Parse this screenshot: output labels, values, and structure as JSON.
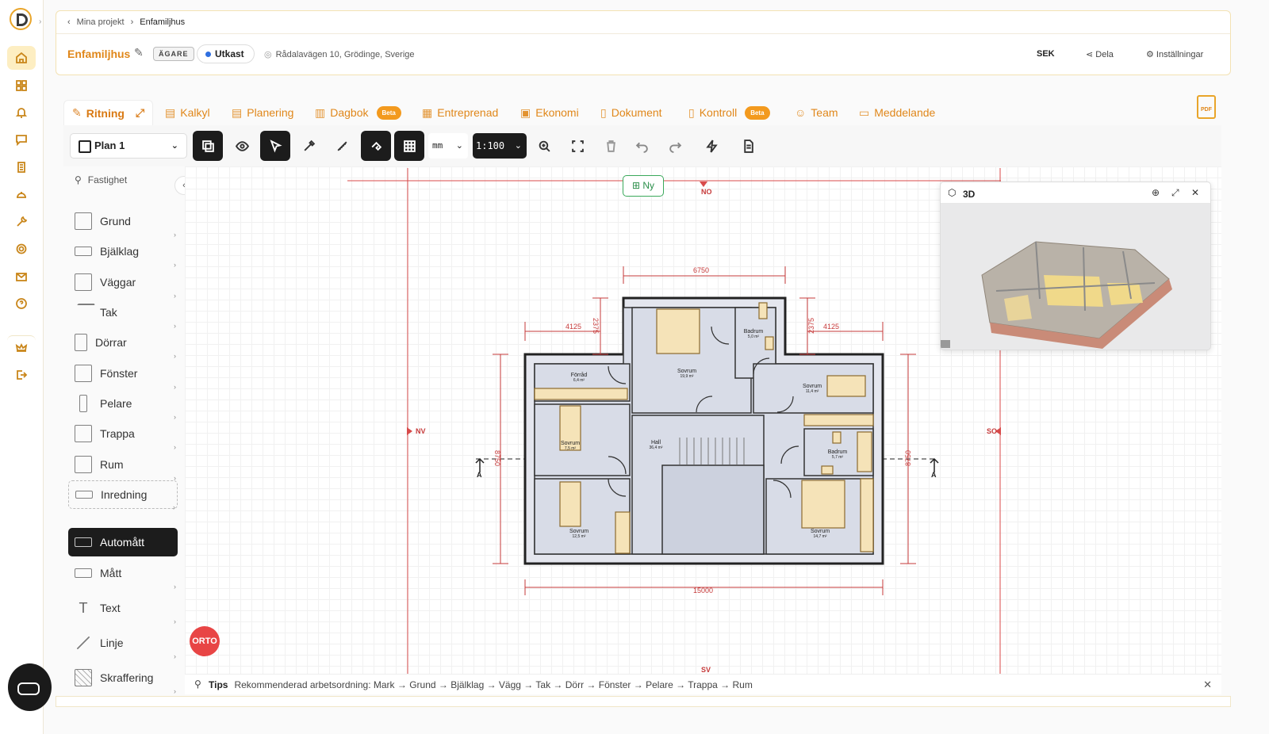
{
  "breadcrumb": {
    "parent": "Mina projekt",
    "current": "Enfamiljhus"
  },
  "project": {
    "title": "Enfamiljhus",
    "role_badge": "ÄGARE",
    "status": "Utkast",
    "address": "Rådalavägen 10, Grödinge, Sverige",
    "currency": "SEK",
    "share_label": "Dela",
    "settings_label": "Inställningar"
  },
  "tabs": [
    {
      "label": "Ritning"
    },
    {
      "label": "Kalkyl"
    },
    {
      "label": "Planering"
    },
    {
      "label": "Dagbok",
      "badge": "Beta"
    },
    {
      "label": "Entreprenad"
    },
    {
      "label": "Ekonomi"
    },
    {
      "label": "Dokument"
    },
    {
      "label": "Kontroll",
      "badge": "Beta"
    },
    {
      "label": "Team"
    },
    {
      "label": "Meddelande"
    }
  ],
  "pdf_label": "PDF",
  "toolbar": {
    "plan": "Plan 1",
    "unit": "mm",
    "scale": "1:100"
  },
  "sidebar": {
    "top": "Fastighet",
    "items": [
      "Grund",
      "Bjälklag",
      "Väggar",
      "Tak",
      "Dörrar",
      "Fönster",
      "Pelare",
      "Trappa",
      "Rum",
      "Inredning"
    ],
    "tools": [
      "Automått",
      "Mått",
      "Text",
      "Linje",
      "Skraffering"
    ]
  },
  "canvas": {
    "new_button": "Ny",
    "orto": "ORTO",
    "directions": {
      "no": "NO",
      "nv": "NV",
      "so": "SO",
      "sv": "SV"
    },
    "section_marker": "A",
    "dims": {
      "top": "6750",
      "left_wing": "4125",
      "right_wing": "4125",
      "left_step": "2375",
      "right_step": "2375",
      "bottom": "15000",
      "left_height": "8750",
      "right_height": "8750"
    },
    "rooms": [
      {
        "name": "Förråd",
        "area": "6,4 m²"
      },
      {
        "name": "Sovrum",
        "area": "19,9 m²"
      },
      {
        "name": "Badrum",
        "area": "5,0 m²"
      },
      {
        "name": "Sovrum",
        "area": "11,4 m²"
      },
      {
        "name": "Sovrum",
        "area": "7,5 m²"
      },
      {
        "name": "Hall",
        "area": "36,4 m²"
      },
      {
        "name": "Badrum",
        "area": "5,7 m²"
      },
      {
        "name": "Sovrum",
        "area": "12,5 m²"
      },
      {
        "name": "Sovrum",
        "area": "14,7 m²"
      }
    ]
  },
  "view3d": {
    "title": "3D"
  },
  "tips": {
    "label": "Tips",
    "text": "Rekommenderad arbetsordning: Mark → Grund → Bjälklag → Vägg → Tak → Dörr → Fönster → Pelare → Trappa → Rum"
  }
}
